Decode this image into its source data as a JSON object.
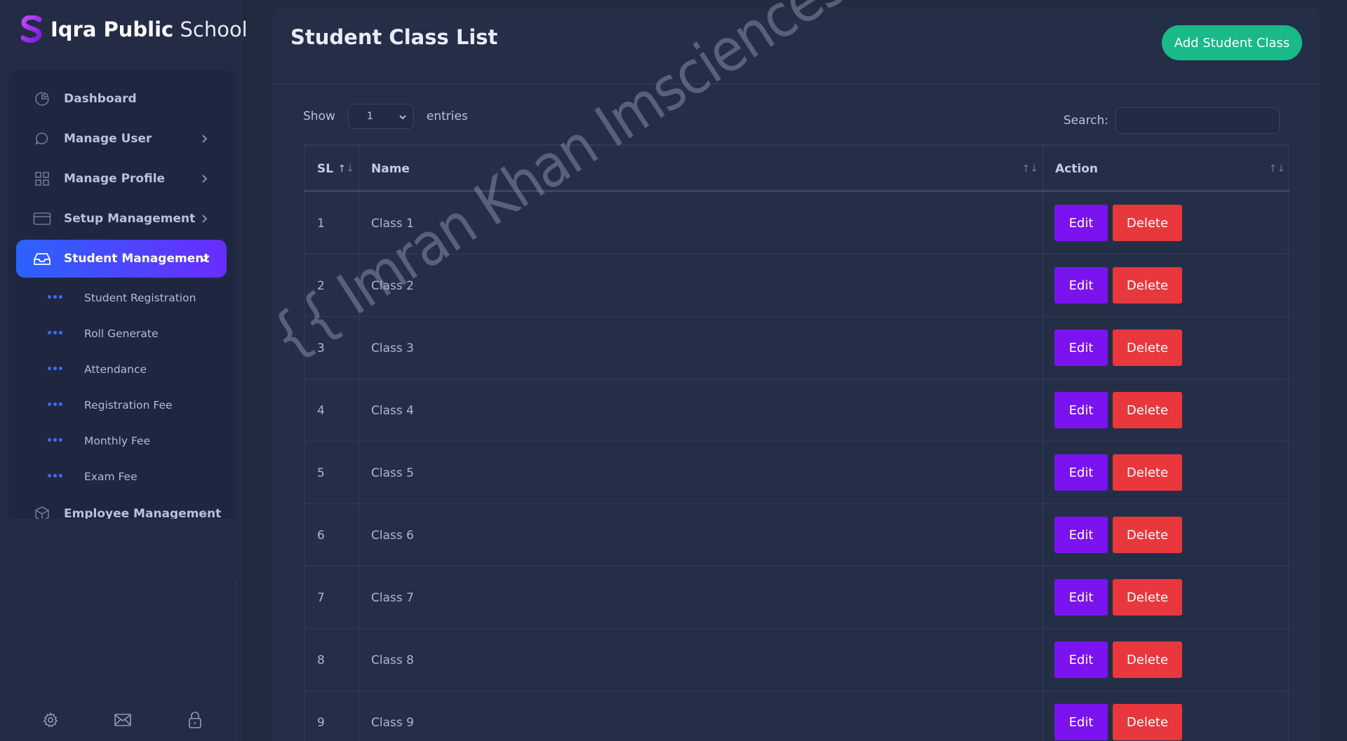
{
  "brand": {
    "bold": "Iqra Public",
    "light": "School"
  },
  "sidebar": {
    "items": [
      {
        "label": "Dashboard",
        "icon": "pie-chart-icon"
      },
      {
        "label": "Manage User",
        "icon": "chat-bubble-icon"
      },
      {
        "label": "Manage Profile",
        "icon": "grid-icon"
      },
      {
        "label": "Setup Management",
        "icon": "credit-card-icon"
      },
      {
        "label": "Student Management",
        "icon": "inbox-icon"
      },
      {
        "label": "Employee Management",
        "icon": "package-icon"
      }
    ],
    "sub_items": [
      {
        "label": "Student Registration"
      },
      {
        "label": "Roll Generate"
      },
      {
        "label": "Attendance"
      },
      {
        "label": "Registration Fee"
      },
      {
        "label": "Monthly Fee"
      },
      {
        "label": "Exam Fee"
      }
    ],
    "footer_icons": [
      "settings-icon",
      "mail-icon",
      "lock-icon"
    ]
  },
  "page": {
    "title": "Student Class List",
    "add_button": "Add Student Class",
    "show_label": "Show",
    "show_value": "1",
    "entries_label": "entries",
    "search_label": "Search:"
  },
  "table": {
    "headers": {
      "sl": "SL",
      "name": "Name",
      "action": "Action"
    },
    "edit_label": "Edit",
    "delete_label": "Delete",
    "rows": [
      {
        "sl": "1",
        "name": "Class 1"
      },
      {
        "sl": "2",
        "name": "Class 2"
      },
      {
        "sl": "3",
        "name": "Class 3"
      },
      {
        "sl": "4",
        "name": "Class 4"
      },
      {
        "sl": "5",
        "name": "Class 5"
      },
      {
        "sl": "6",
        "name": "Class 6"
      },
      {
        "sl": "7",
        "name": "Class 7"
      },
      {
        "sl": "8",
        "name": "Class 8"
      },
      {
        "sl": "9",
        "name": "Class 9"
      }
    ]
  },
  "watermark": "{{ Imran Khan Imsciences }}",
  "colors": {
    "accent_gradient_start": "#2b63ff",
    "accent_gradient_end": "#6a2cff",
    "add_button": "#19b98a",
    "edit_button": "#7a13f0",
    "delete_button": "#e8373d"
  }
}
